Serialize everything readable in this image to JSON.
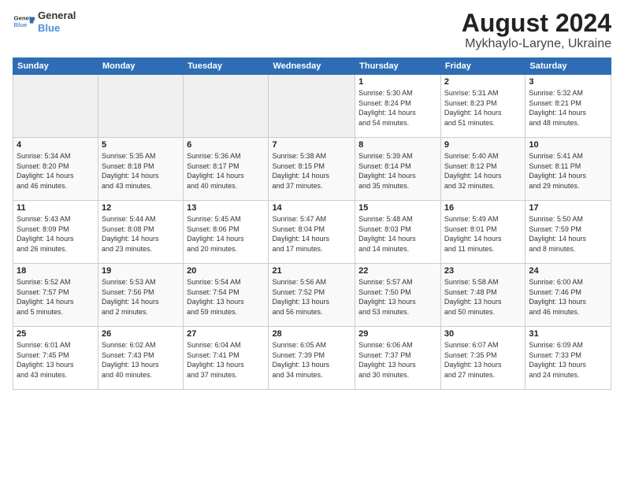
{
  "logo": {
    "line1": "General",
    "line2": "Blue"
  },
  "title": "August 2024",
  "subtitle": "Mykhaylo-Laryne, Ukraine",
  "days_of_week": [
    "Sunday",
    "Monday",
    "Tuesday",
    "Wednesday",
    "Thursday",
    "Friday",
    "Saturday"
  ],
  "weeks": [
    [
      {
        "day": "",
        "info": ""
      },
      {
        "day": "",
        "info": ""
      },
      {
        "day": "",
        "info": ""
      },
      {
        "day": "",
        "info": ""
      },
      {
        "day": "1",
        "info": "Sunrise: 5:30 AM\nSunset: 8:24 PM\nDaylight: 14 hours\nand 54 minutes."
      },
      {
        "day": "2",
        "info": "Sunrise: 5:31 AM\nSunset: 8:23 PM\nDaylight: 14 hours\nand 51 minutes."
      },
      {
        "day": "3",
        "info": "Sunrise: 5:32 AM\nSunset: 8:21 PM\nDaylight: 14 hours\nand 48 minutes."
      }
    ],
    [
      {
        "day": "4",
        "info": "Sunrise: 5:34 AM\nSunset: 8:20 PM\nDaylight: 14 hours\nand 46 minutes."
      },
      {
        "day": "5",
        "info": "Sunrise: 5:35 AM\nSunset: 8:18 PM\nDaylight: 14 hours\nand 43 minutes."
      },
      {
        "day": "6",
        "info": "Sunrise: 5:36 AM\nSunset: 8:17 PM\nDaylight: 14 hours\nand 40 minutes."
      },
      {
        "day": "7",
        "info": "Sunrise: 5:38 AM\nSunset: 8:15 PM\nDaylight: 14 hours\nand 37 minutes."
      },
      {
        "day": "8",
        "info": "Sunrise: 5:39 AM\nSunset: 8:14 PM\nDaylight: 14 hours\nand 35 minutes."
      },
      {
        "day": "9",
        "info": "Sunrise: 5:40 AM\nSunset: 8:12 PM\nDaylight: 14 hours\nand 32 minutes."
      },
      {
        "day": "10",
        "info": "Sunrise: 5:41 AM\nSunset: 8:11 PM\nDaylight: 14 hours\nand 29 minutes."
      }
    ],
    [
      {
        "day": "11",
        "info": "Sunrise: 5:43 AM\nSunset: 8:09 PM\nDaylight: 14 hours\nand 26 minutes."
      },
      {
        "day": "12",
        "info": "Sunrise: 5:44 AM\nSunset: 8:08 PM\nDaylight: 14 hours\nand 23 minutes."
      },
      {
        "day": "13",
        "info": "Sunrise: 5:45 AM\nSunset: 8:06 PM\nDaylight: 14 hours\nand 20 minutes."
      },
      {
        "day": "14",
        "info": "Sunrise: 5:47 AM\nSunset: 8:04 PM\nDaylight: 14 hours\nand 17 minutes."
      },
      {
        "day": "15",
        "info": "Sunrise: 5:48 AM\nSunset: 8:03 PM\nDaylight: 14 hours\nand 14 minutes."
      },
      {
        "day": "16",
        "info": "Sunrise: 5:49 AM\nSunset: 8:01 PM\nDaylight: 14 hours\nand 11 minutes."
      },
      {
        "day": "17",
        "info": "Sunrise: 5:50 AM\nSunset: 7:59 PM\nDaylight: 14 hours\nand 8 minutes."
      }
    ],
    [
      {
        "day": "18",
        "info": "Sunrise: 5:52 AM\nSunset: 7:57 PM\nDaylight: 14 hours\nand 5 minutes."
      },
      {
        "day": "19",
        "info": "Sunrise: 5:53 AM\nSunset: 7:56 PM\nDaylight: 14 hours\nand 2 minutes."
      },
      {
        "day": "20",
        "info": "Sunrise: 5:54 AM\nSunset: 7:54 PM\nDaylight: 13 hours\nand 59 minutes."
      },
      {
        "day": "21",
        "info": "Sunrise: 5:56 AM\nSunset: 7:52 PM\nDaylight: 13 hours\nand 56 minutes."
      },
      {
        "day": "22",
        "info": "Sunrise: 5:57 AM\nSunset: 7:50 PM\nDaylight: 13 hours\nand 53 minutes."
      },
      {
        "day": "23",
        "info": "Sunrise: 5:58 AM\nSunset: 7:48 PM\nDaylight: 13 hours\nand 50 minutes."
      },
      {
        "day": "24",
        "info": "Sunrise: 6:00 AM\nSunset: 7:46 PM\nDaylight: 13 hours\nand 46 minutes."
      }
    ],
    [
      {
        "day": "25",
        "info": "Sunrise: 6:01 AM\nSunset: 7:45 PM\nDaylight: 13 hours\nand 43 minutes."
      },
      {
        "day": "26",
        "info": "Sunrise: 6:02 AM\nSunset: 7:43 PM\nDaylight: 13 hours\nand 40 minutes."
      },
      {
        "day": "27",
        "info": "Sunrise: 6:04 AM\nSunset: 7:41 PM\nDaylight: 13 hours\nand 37 minutes."
      },
      {
        "day": "28",
        "info": "Sunrise: 6:05 AM\nSunset: 7:39 PM\nDaylight: 13 hours\nand 34 minutes."
      },
      {
        "day": "29",
        "info": "Sunrise: 6:06 AM\nSunset: 7:37 PM\nDaylight: 13 hours\nand 30 minutes."
      },
      {
        "day": "30",
        "info": "Sunrise: 6:07 AM\nSunset: 7:35 PM\nDaylight: 13 hours\nand 27 minutes."
      },
      {
        "day": "31",
        "info": "Sunrise: 6:09 AM\nSunset: 7:33 PM\nDaylight: 13 hours\nand 24 minutes."
      }
    ]
  ]
}
